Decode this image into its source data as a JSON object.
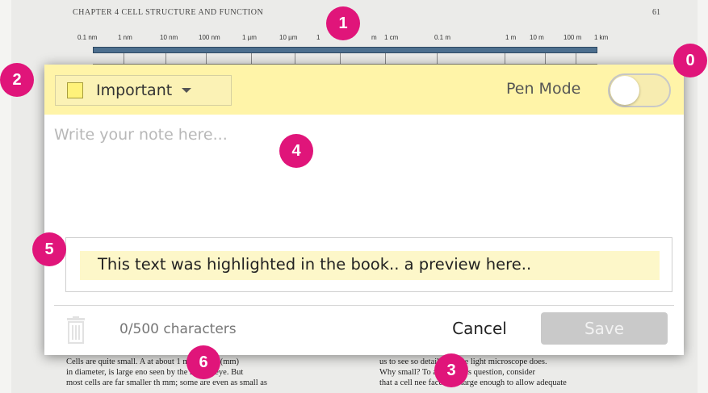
{
  "book": {
    "header": "CHAPTER 4  CELL STRUCTURE AND FUNCTION",
    "page_number": "61",
    "scale_labels": [
      "0.1 nm",
      "1 nm",
      "10 nm",
      "100 nm",
      "1 µm",
      "10 µm",
      "1",
      "m",
      "1 cm",
      "0.1 m",
      "1 m",
      "10 m",
      "100 m",
      "1 km"
    ],
    "left_column": [
      "Cells are quite small. A                    at about 1 millimeter (mm)",
      "in diameter, is large eno                   seen by the human eye. But",
      "most cells are far smaller th                mm; some are even as small as"
    ],
    "right_column": [
      "us to see so                        detail than the light microscope does.",
      "      Why                        small? To answer this question, consider",
      "that a cell nee                 face area large enough to allow adequate"
    ]
  },
  "badges": [
    "0",
    "1",
    "2",
    "3",
    "4",
    "5",
    "6"
  ],
  "dialog": {
    "category": {
      "label": "Important",
      "swatch_color": "#fff27a"
    },
    "pen_mode": {
      "label": "Pen Mode",
      "on": false
    },
    "note": {
      "placeholder": "Write your note here...",
      "value": ""
    },
    "highlight_preview": "This text was highlighted in the book.. a preview here..",
    "char_count": "0/500 characters",
    "cancel_label": "Cancel",
    "save_label": "Save",
    "icons": {
      "delete": "trash-icon",
      "dropdown": "chevron-down-icon"
    }
  },
  "colors": {
    "header_bg": "#fff4a8",
    "badge": "#e0157a",
    "save_disabled": "#c9c9c9",
    "highlight_bg": "#fdf7c9"
  }
}
